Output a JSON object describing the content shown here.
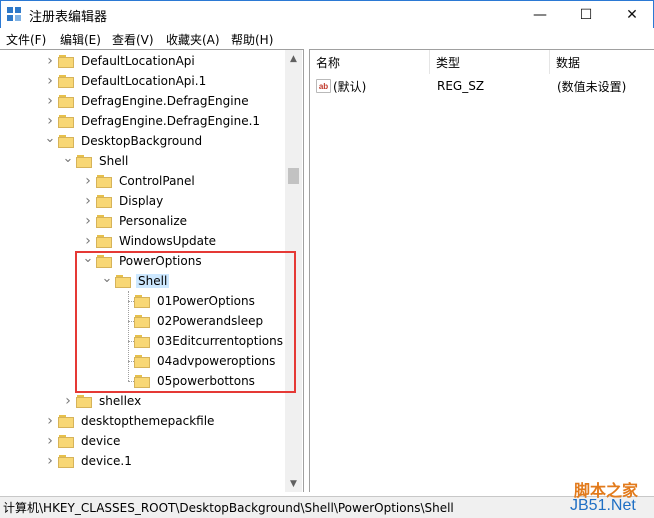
{
  "window": {
    "title": "注册表编辑器",
    "min_glyph": "—",
    "max_glyph": "☐",
    "close_glyph": "✕"
  },
  "menu": [
    "文件(F)",
    "编辑(E)",
    "查看(V)",
    "收藏夹(A)",
    "帮助(H)"
  ],
  "tree": [
    {
      "label": "DefaultLocationApi",
      "level": 0,
      "expander": "collapsed"
    },
    {
      "label": "DefaultLocationApi.1",
      "level": 0,
      "expander": "collapsed"
    },
    {
      "label": "DefragEngine.DefragEngine",
      "level": 0,
      "expander": "collapsed"
    },
    {
      "label": "DefragEngine.DefragEngine.1",
      "level": 0,
      "expander": "collapsed"
    },
    {
      "label": "DesktopBackground",
      "level": 0,
      "expander": "expanded"
    },
    {
      "label": "Shell",
      "level": 1,
      "expander": "expanded"
    },
    {
      "label": "ControlPanel",
      "level": 2,
      "expander": "collapsed"
    },
    {
      "label": "Display",
      "level": 2,
      "expander": "collapsed"
    },
    {
      "label": "Personalize",
      "level": 2,
      "expander": "collapsed"
    },
    {
      "label": "WindowsUpdate",
      "level": 2,
      "expander": "collapsed"
    },
    {
      "label": "PowerOptions",
      "level": 2,
      "expander": "expanded"
    },
    {
      "label": "Shell",
      "level": 3,
      "expander": "expanded",
      "selected": true
    },
    {
      "label": "01PowerOptions",
      "level": 4,
      "expander": "none"
    },
    {
      "label": "02Powerandsleep",
      "level": 4,
      "expander": "none"
    },
    {
      "label": "03Editcurrentoptions",
      "level": 4,
      "expander": "none"
    },
    {
      "label": "04advpoweroptions",
      "level": 4,
      "expander": "none"
    },
    {
      "label": "05powerbottons",
      "level": 4,
      "expander": "none"
    },
    {
      "label": "shellex",
      "level": 1,
      "expander": "collapsed"
    },
    {
      "label": "desktopthemepackfile",
      "level": 0,
      "expander": "collapsed"
    },
    {
      "label": "device",
      "level": 0,
      "expander": "collapsed"
    },
    {
      "label": "device.1",
      "level": 0,
      "expander": "collapsed"
    }
  ],
  "list": {
    "headers": [
      "名称",
      "类型",
      "数据"
    ],
    "rows": [
      {
        "icon": "ab",
        "name": "(默认)",
        "type": "REG_SZ",
        "data": "(数值未设置)"
      }
    ]
  },
  "status": {
    "path": "计算机\\HKEY_CLASSES_ROOT\\DesktopBackground\\Shell\\PowerOptions\\Shell"
  },
  "watermark": {
    "top": "脚本之家",
    "bottom": "JB51.Net"
  },
  "icons": {
    "app": "registry-editor-icon",
    "folder": "folder-icon",
    "string_value": "string-value-icon"
  },
  "colors": {
    "selection": "#cde8ff",
    "highlight_box": "#e53935",
    "folder": "#f8d775"
  }
}
